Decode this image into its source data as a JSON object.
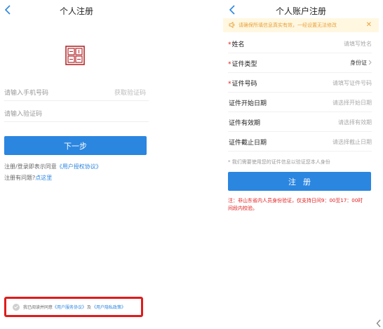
{
  "left": {
    "title": "个人注册",
    "phone_placeholder": "请输入手机号码",
    "get_code": "获取验证码",
    "code_placeholder": "请输入验证码",
    "next_button": "下一步",
    "agree_prefix": "注册/登录即表示同意",
    "agree_link": "《用户授权协议》",
    "help_prefix": "注册有问题?",
    "help_link": "点这里",
    "consent_prefix": "我已阅读并同意",
    "consent_link1": "《用户服务协议》",
    "consent_and": "及",
    "consent_link2": "《用户隐私政策》"
  },
  "right": {
    "title": "个人账户注册",
    "notice": "请确保所填信息真实有效，一经设置无法修改",
    "fields": [
      {
        "label": "姓名",
        "required": "*",
        "value": "请填写姓名"
      },
      {
        "label": "证件类型",
        "required": "*",
        "value": "身份证"
      },
      {
        "label": "证件号码",
        "required": "*",
        "value": "请填写证件号码"
      },
      {
        "label": "证件开始日期",
        "required": "",
        "value": "请选择开始日期"
      },
      {
        "label": "证件有效期",
        "required": "",
        "value": "请选择有效期"
      },
      {
        "label": "证件截止日期",
        "required": "",
        "value": "请选择截止日期"
      }
    ],
    "tip": "* 我们需要使用您的证件信息以验证您本人身份",
    "register_button": "注册",
    "note_line1": "注：非山东省内人员身份验证，仅支持日间9：00至17：00时",
    "note_line2": "间段内校验。"
  },
  "colors": {
    "accent": "#2b86e0",
    "alert_red": "#e11b1b",
    "notice_bg": "#fff7e0",
    "notice_text": "#e8a23c"
  },
  "icons": [
    "back-arrow-icon",
    "seal-logo-icon",
    "speaker-icon",
    "close-icon",
    "chevron-right-icon",
    "check-circle-icon"
  ]
}
